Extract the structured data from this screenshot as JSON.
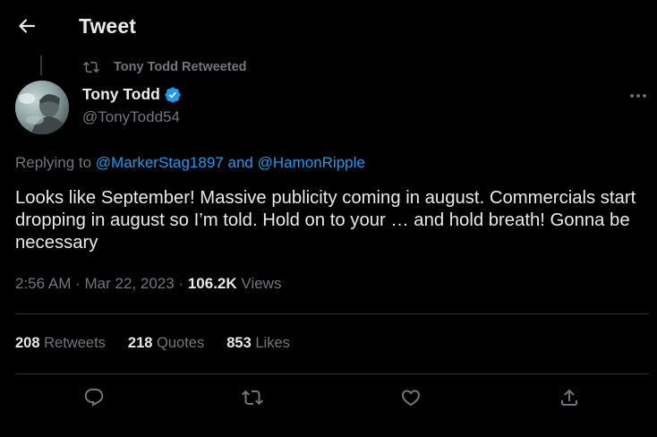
{
  "header": {
    "title": "Tweet",
    "back_icon": "arrow-left-icon"
  },
  "retweet_context": {
    "icon": "retweet-icon",
    "text": "Tony Todd Retweeted"
  },
  "author": {
    "name": "Tony Todd",
    "handle": "@TonyTodd54",
    "verified_icon": "verified-badge-icon",
    "verified_color": "#1d9bf0"
  },
  "reply_context": {
    "prefix": "Replying to",
    "mention_1": "@MarkerStag1897",
    "conjunction": "and",
    "mention_2": "@HamonRipple"
  },
  "tweet": {
    "text": "Looks like September! Massive publicity coming in august. Commercials start dropping in august so I’m told. Hold on to your … and hold breath! Gonna be necessary"
  },
  "meta": {
    "time": "2:56 AM",
    "separator": "·",
    "date": "Mar 22, 2023",
    "views_count": "106.2K",
    "views_label": "Views"
  },
  "stats": {
    "retweets_count": "208",
    "retweets_label": "Retweets",
    "quotes_count": "218",
    "quotes_label": "Quotes",
    "likes_count": "853",
    "likes_label": "Likes"
  },
  "actions": {
    "reply_icon": "reply-icon",
    "retweet_icon": "retweet-icon",
    "like_icon": "heart-icon",
    "share_icon": "share-icon"
  },
  "colors": {
    "background": "#000000",
    "text_primary": "#e7e9ea",
    "text_secondary": "#71767b",
    "accent": "#1d9bf0",
    "divider": "#2f3336"
  }
}
